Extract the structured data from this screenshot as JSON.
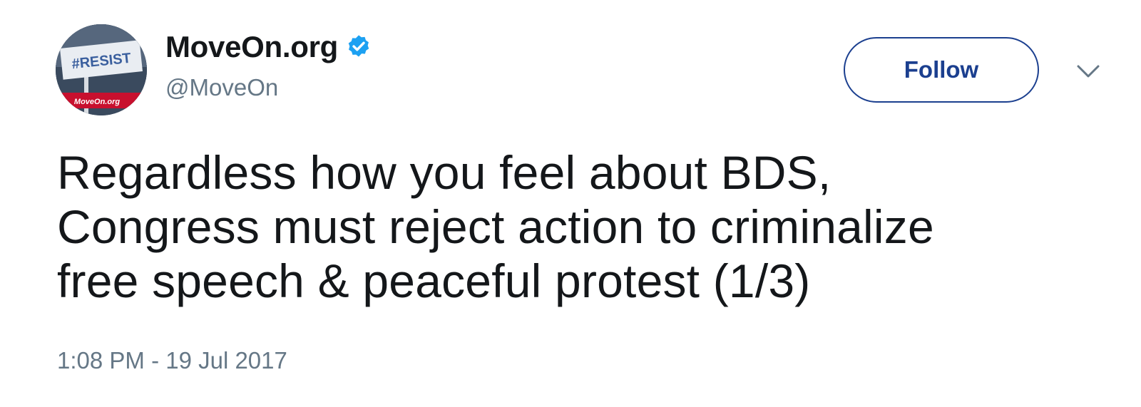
{
  "user": {
    "display_name": "MoveOn.org",
    "handle": "@MoveOn",
    "verified": true,
    "avatar": {
      "sign_text": "#RESIST",
      "banner_text": "MoveOn.org",
      "icon": "avatar-image"
    }
  },
  "actions": {
    "follow_label": "Follow",
    "menu_icon": "chevron-down-icon"
  },
  "tweet": {
    "lines": [
      "Regardless how you feel about BDS,",
      "Congress must reject action to criminalize",
      "free speech & peaceful protest (1/3)"
    ],
    "timestamp": "1:08 PM - 19 Jul 2017"
  },
  "colors": {
    "text": "#14171a",
    "muted": "#657786",
    "follow_accent": "#1b3f8f",
    "verified_badge": "#1da1f2",
    "background": "#ffffff"
  }
}
